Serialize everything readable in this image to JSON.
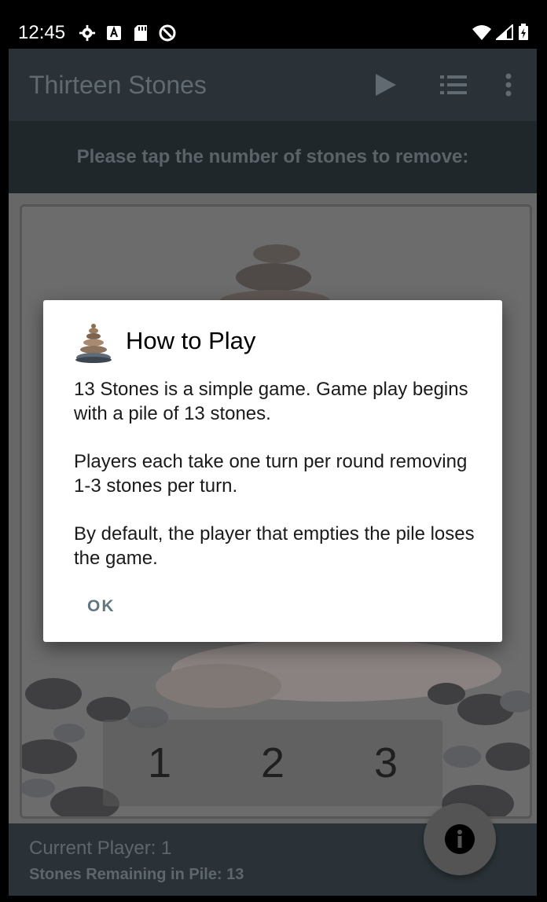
{
  "status_bar": {
    "time": "12:45"
  },
  "app_bar": {
    "title": "Thirteen Stones"
  },
  "instruction": "Please tap the number of stones to remove:",
  "choices": [
    "1",
    "2",
    "3"
  ],
  "footer": {
    "current_player": "Current Player: 1",
    "stones_remaining": "Stones Remaining in Pile: 13"
  },
  "dialog": {
    "title": "How to Play",
    "paragraphs": [
      "13 Stones is a simple game. Game play begins with a pile of 13 stones.",
      "Players each take one turn per round removing 1-3 stones per turn.",
      "By default, the player that empties the pile loses the game."
    ],
    "ok_label": "OK"
  },
  "colors": {
    "app_bar": "#2a3237",
    "instruction_bar": "#1f272b",
    "dialog_button": "#5f7683"
  }
}
